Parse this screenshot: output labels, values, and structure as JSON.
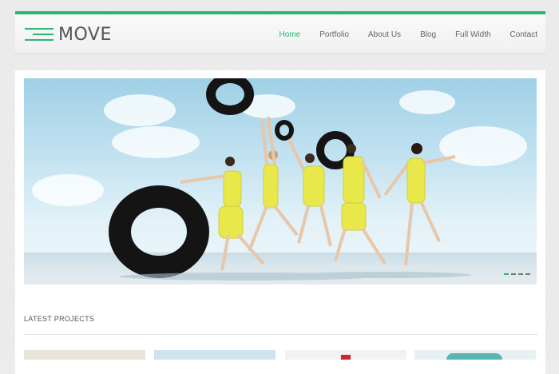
{
  "brand": {
    "name": "MOVE",
    "accent": "#2bb673"
  },
  "nav": {
    "items": [
      {
        "label": "Home",
        "active": true
      },
      {
        "label": "Portfolio",
        "active": false
      },
      {
        "label": "About Us",
        "active": false
      },
      {
        "label": "Blog",
        "active": false
      },
      {
        "label": "Full Width",
        "active": false
      },
      {
        "label": "Contact",
        "active": false
      }
    ]
  },
  "slider": {
    "slide_count": 4,
    "active_index": 0
  },
  "projects": {
    "title": "LATEST PROJECTS",
    "thumbs": [
      {
        "color": "#e9e5da"
      },
      {
        "color": "#cfe3ee"
      },
      {
        "color": "#f2f2f2"
      },
      {
        "color": "#e7f1f3"
      }
    ]
  }
}
